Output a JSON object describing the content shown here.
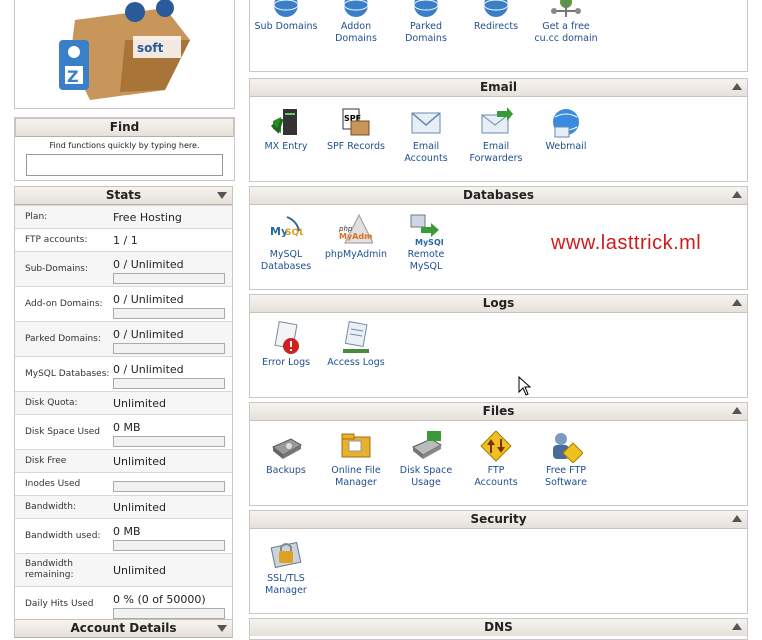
{
  "find": {
    "title": "Find",
    "hint": "Find functions quickly by typing here.",
    "placeholder": ""
  },
  "stats": {
    "title": "Stats",
    "rows": [
      {
        "label": "Plan:",
        "value": "Free Hosting",
        "bar": false
      },
      {
        "label": "FTP accounts:",
        "value": "1 / 1",
        "bar": false
      },
      {
        "label": "Sub-Domains:",
        "value": "0 / Unlimited",
        "bar": true
      },
      {
        "label": "Add-on Domains:",
        "value": "0 / Unlimited",
        "bar": true
      },
      {
        "label": "Parked Domains:",
        "value": "0 / Unlimited",
        "bar": true
      },
      {
        "label": "MySQL Databases:",
        "value": "0 / Unlimited",
        "bar": true
      },
      {
        "label": "Disk Quota:",
        "value": "Unlimited",
        "bar": false
      },
      {
        "label": "Disk Space Used",
        "value": "0 MB",
        "bar": true
      },
      {
        "label": "Disk Free",
        "value": "Unlimited",
        "bar": false
      },
      {
        "label": "Inodes Used",
        "value": "",
        "bar": true
      },
      {
        "label": "Bandwidth:",
        "value": "Unlimited",
        "bar": false
      },
      {
        "label": "Bandwidth used:",
        "value": "0 MB",
        "bar": true
      },
      {
        "label": "Bandwidth remaining:",
        "value": "Unlimited",
        "bar": false
      },
      {
        "label": "Daily Hits Used",
        "value": "0 % (0 of 50000)",
        "bar": true
      }
    ]
  },
  "account_details": {
    "title": "Account Details"
  },
  "domains": {
    "items": [
      {
        "l1": "Sub Domains",
        "l2": "",
        "icon": "www-globe-icon"
      },
      {
        "l1": "Addon",
        "l2": "Domains",
        "icon": "www-globe-icon"
      },
      {
        "l1": "Parked",
        "l2": "Domains",
        "icon": "www-globe-icon"
      },
      {
        "l1": "Redirects",
        "l2": "",
        "icon": "www-globe-icon"
      },
      {
        "l1": "Get a free",
        "l2": "cu.cc domain",
        "icon": "network-icon"
      }
    ]
  },
  "email": {
    "title": "Email",
    "items": [
      {
        "l1": "MX Entry",
        "l2": "",
        "icon": "mx-server-icon"
      },
      {
        "l1": "SPF Records",
        "l2": "",
        "icon": "spf-icon"
      },
      {
        "l1": "Email",
        "l2": "Accounts",
        "icon": "envelope-icon"
      },
      {
        "l1": "Email",
        "l2": "Forwarders",
        "icon": "envelope-arrow-icon"
      },
      {
        "l1": "Webmail",
        "l2": "",
        "icon": "webmail-globe-icon"
      }
    ]
  },
  "databases": {
    "title": "Databases",
    "items": [
      {
        "l1": "MySQL",
        "l2": "Databases",
        "icon": "mysql-icon"
      },
      {
        "l1": "phpMyAdmin",
        "l2": "",
        "icon": "phpmyadmin-icon"
      },
      {
        "l1": "Remote",
        "l2": "MySQL",
        "icon": "remote-mysql-icon"
      }
    ]
  },
  "watermark": "www.lasttrick.ml",
  "logs": {
    "title": "Logs",
    "items": [
      {
        "l1": "Error Logs",
        "l2": "",
        "icon": "error-log-icon"
      },
      {
        "l1": "Access Logs",
        "l2": "",
        "icon": "access-log-icon"
      }
    ]
  },
  "files": {
    "title": "Files",
    "items": [
      {
        "l1": "Backups",
        "l2": "",
        "icon": "backup-disk-icon"
      },
      {
        "l1": "Online File",
        "l2": "Manager",
        "icon": "folder-icon"
      },
      {
        "l1": "Disk Space",
        "l2": "Usage",
        "icon": "disk-usage-icon"
      },
      {
        "l1": "FTP",
        "l2": "Accounts",
        "icon": "ftp-icon"
      },
      {
        "l1": "Free FTP",
        "l2": "Software",
        "icon": "ftp-software-icon"
      }
    ]
  },
  "security": {
    "title": "Security",
    "items": [
      {
        "l1": "SSL/TLS",
        "l2": "Manager",
        "icon": "ssl-icon"
      }
    ]
  },
  "dns": {
    "title": "DNS"
  },
  "colors": {
    "link": "#1f4f8f",
    "watermark": "#d11a1a",
    "header_bg": "#ebe6df"
  }
}
